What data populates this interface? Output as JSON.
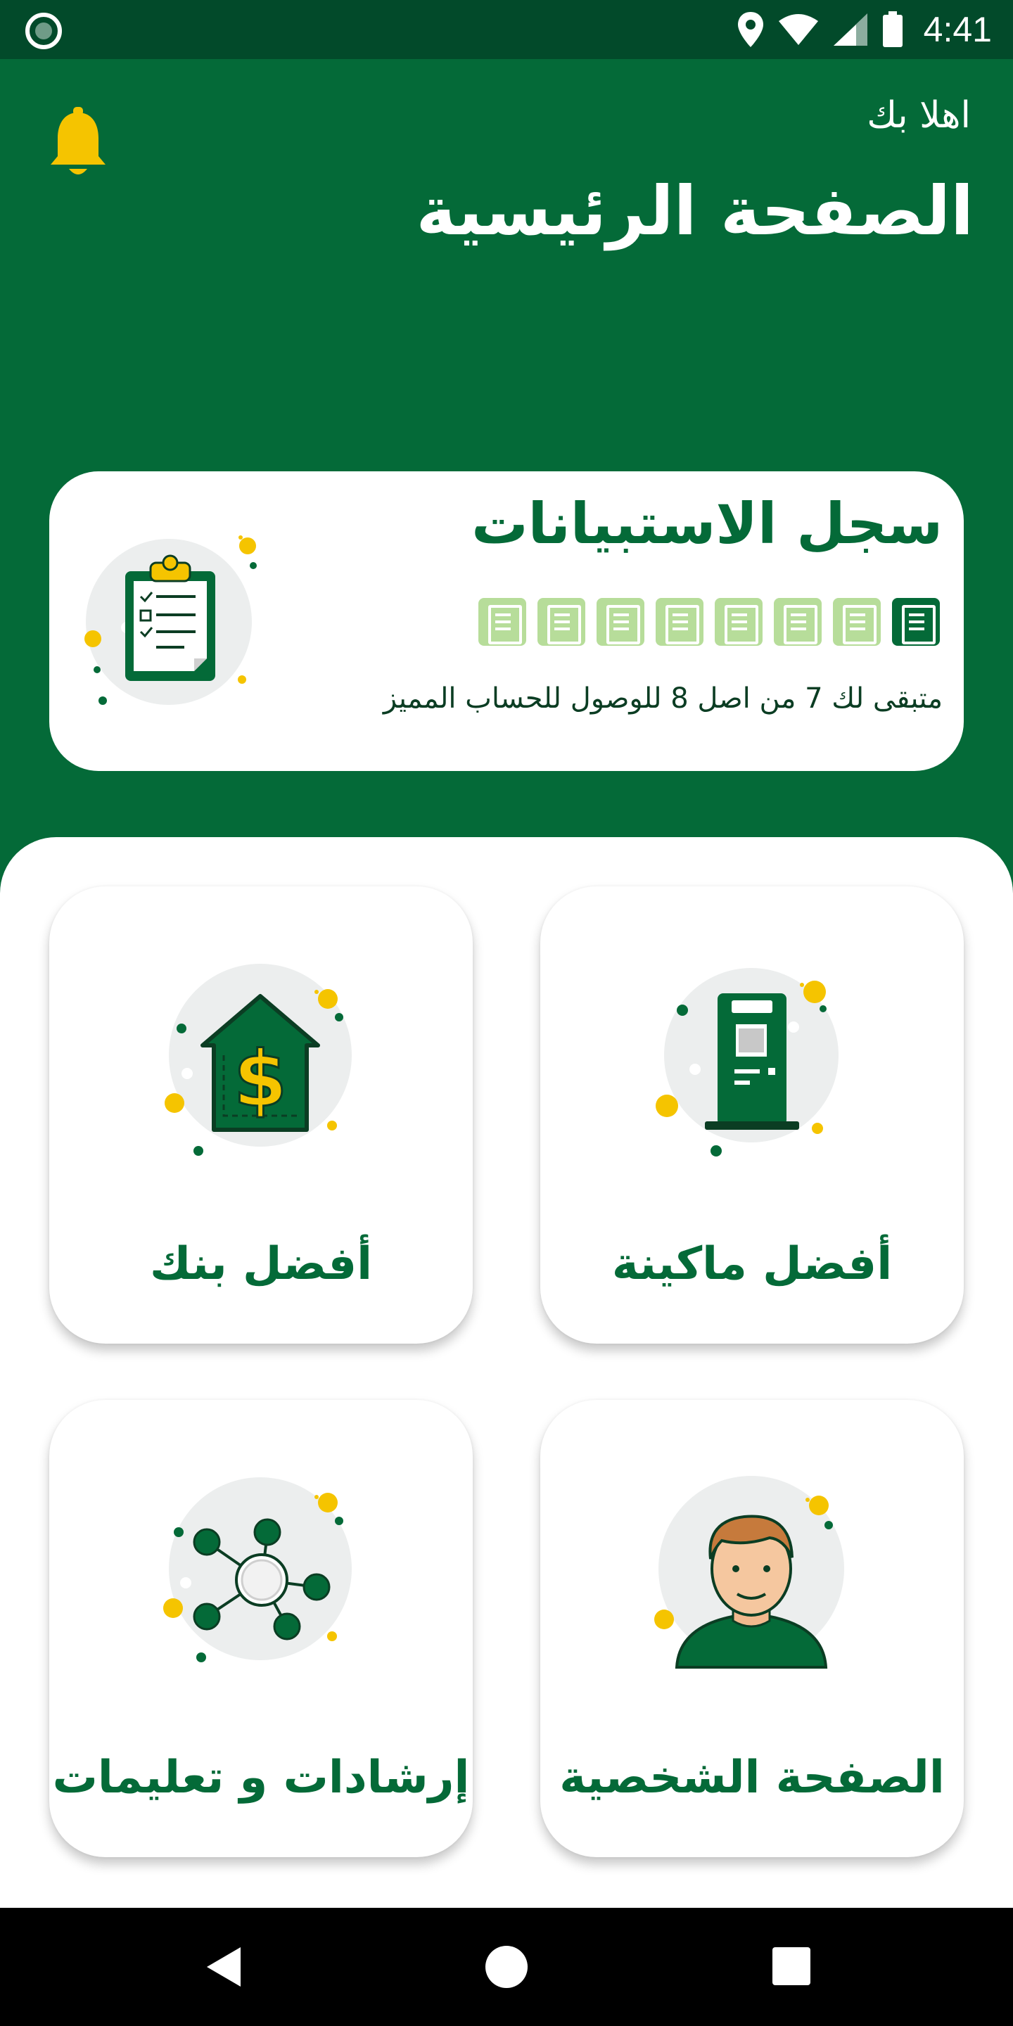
{
  "status_bar": {
    "time": "4:41",
    "icons": [
      "app-indicator-icon",
      "location-icon",
      "wifi-icon",
      "signal-icon",
      "battery-icon"
    ]
  },
  "header": {
    "greeting": "اهلا بك",
    "title": "الصفحة الرئيسية",
    "bell_icon": "notification-bell-icon",
    "background_color": "#046a38",
    "bell_color": "#f5c400"
  },
  "survey_card": {
    "title": "سجل الاستبيانات",
    "completed": 1,
    "total": 8,
    "remaining_text": "متبقى لك 7 من اصل 8 للوصول للحساب المميز",
    "icon": "clipboard-checklist-icon"
  },
  "tiles": [
    {
      "id": "best-machine",
      "label": "أفضل ماكينة",
      "icon": "atm-machine-icon"
    },
    {
      "id": "best-bank",
      "label": "أفضل بنك",
      "icon": "bank-dollar-icon"
    },
    {
      "id": "profile",
      "label": "الصفحة الشخصية",
      "icon": "user-avatar-icon"
    },
    {
      "id": "guidelines",
      "label": "إرشادات و تعليمات",
      "icon": "network-nodes-icon"
    }
  ],
  "nav_bar": {
    "icons": [
      "back-icon",
      "home-icon",
      "recent-apps-icon"
    ]
  },
  "colors": {
    "brand_green": "#046a38",
    "dark_green": "#024a2a",
    "light_green": "#b7dd9a",
    "accent_yellow": "#f5c400"
  }
}
